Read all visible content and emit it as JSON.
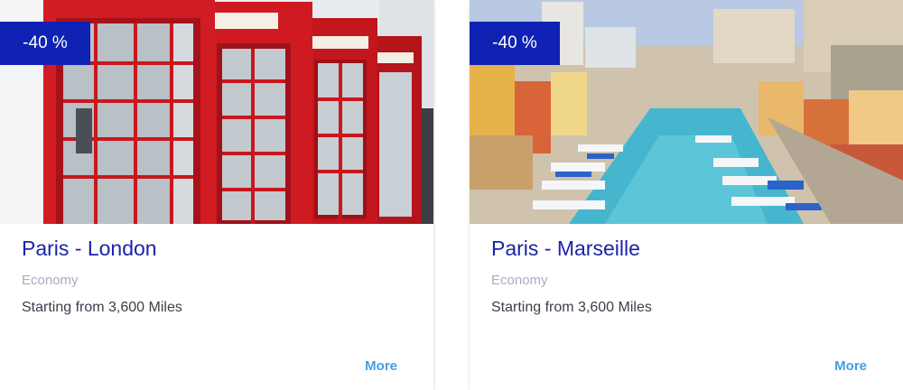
{
  "offers": [
    {
      "badge": "-40 %",
      "route": "Paris - London",
      "cabin_class": "Economy",
      "price_text": "Starting from 3,600 Miles",
      "more_label": "More",
      "image": "london-red-phone-boxes-photo"
    },
    {
      "badge": "-40 %",
      "route": "Paris - Marseille",
      "cabin_class": "Economy",
      "price_text": "Starting from 3,600 Miles",
      "more_label": "More",
      "image": "marseille-harbor-photo"
    }
  ],
  "colors": {
    "badge_bg": "#0f22b4",
    "route_text": "#1a24a8",
    "class_text": "#a7adc2",
    "more_link": "#3fa0e6"
  }
}
